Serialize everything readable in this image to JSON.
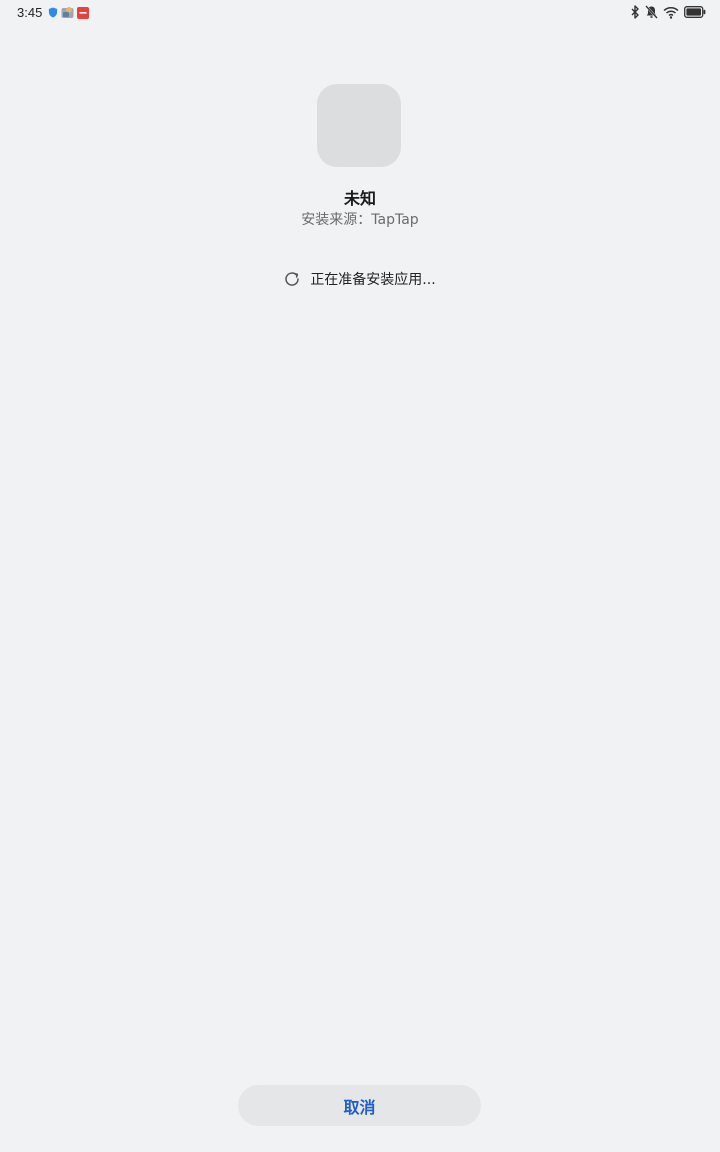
{
  "status_bar": {
    "time": "3:45",
    "notification_icons": [
      "shield-icon",
      "app-icon",
      "red-app-icon"
    ],
    "system_icons": [
      "bluetooth-icon",
      "mute-icon",
      "wifi-icon",
      "battery-icon"
    ]
  },
  "app": {
    "name": "未知",
    "source_label": "安装来源：TapTap"
  },
  "progress": {
    "text": "正在准备安装应用..."
  },
  "actions": {
    "cancel_label": "取消"
  },
  "colors": {
    "background": "#f1f2f4",
    "accent": "#1f5fc7",
    "icon_placeholder": "#dcdddf",
    "button_bg": "#e5e6e8"
  }
}
